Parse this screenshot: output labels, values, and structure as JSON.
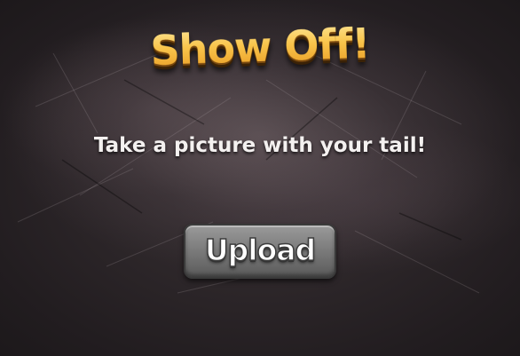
{
  "game": {
    "title": "Show Off!",
    "instruction": "Take a picture with your tail!",
    "upload_label": "Upload"
  },
  "colors": {
    "background": "#1b1818",
    "title_fill": "#f7c349",
    "title_shadow": "#7a4a10",
    "text": "#f4f1f0",
    "button_fill": "#7d7d7d"
  }
}
